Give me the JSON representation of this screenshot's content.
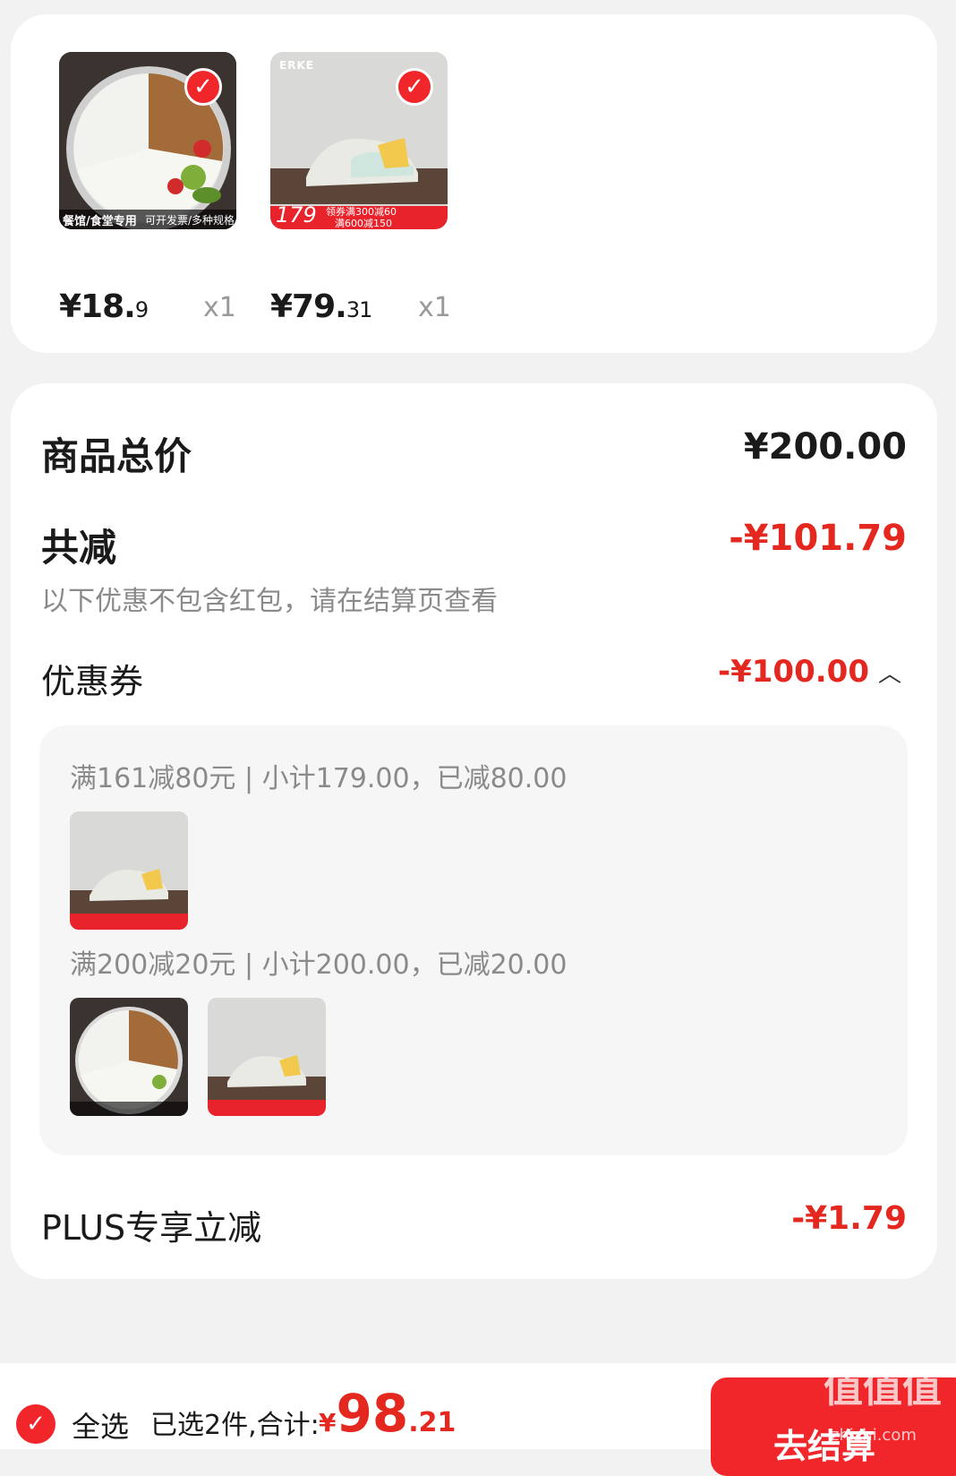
{
  "products": [
    {
      "image_name": "lunch-tray-product-image",
      "image_caption_left": "餐馆/食堂专用",
      "image_caption_right": "可开发票/多种规格",
      "price_int": "¥18.",
      "price_dec": "9",
      "qty": "x1",
      "selected": true
    },
    {
      "image_name": "sneaker-product-image",
      "brand": "ERKE",
      "price_tag": "179",
      "promo_line1": "领券满300减60",
      "promo_line2": "满600减150",
      "price_int": "¥79.",
      "price_dec": "31",
      "qty": "x1",
      "selected": true
    }
  ],
  "summary": {
    "total_label": "商品总价",
    "total_value": "¥200.00",
    "discount_label": "共减",
    "discount_value": "-¥101.79",
    "discount_note": "以下优惠不包含红包，请在结算页查看",
    "coupon_label": "优惠券",
    "coupon_value": "-¥100.00",
    "coupon_rules": [
      {
        "text": "满161减80元 | 小计179.00，已减80.00"
      },
      {
        "text": "满200减20元 | 小计200.00，已减20.00"
      }
    ],
    "plus_label": "PLUS专享立减",
    "plus_value": "-¥1.79"
  },
  "bottom_bar": {
    "select_all_label": "全选",
    "selected_summary": "已选2件,合计:",
    "currency": "¥",
    "total_int": "98",
    "total_dec": ".21",
    "checkout_label": "去结算",
    "watermark_text": "值值值",
    "watermark_url": "zhizhi.com"
  },
  "colors": {
    "accent": "#f0262b",
    "discount_red": "#e4281f",
    "muted_text": "#8a8a8a",
    "page_bg": "#f2f2f2"
  }
}
